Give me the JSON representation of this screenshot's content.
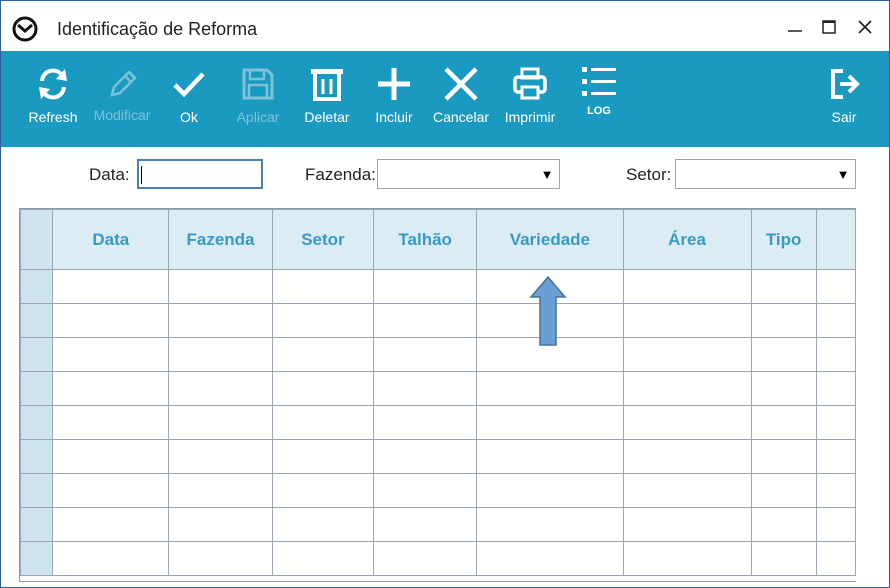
{
  "window": {
    "title": "Identificação de Reforma",
    "controls": [
      "minimize-icon",
      "maximize-icon",
      "close-icon"
    ]
  },
  "toolbar": {
    "background": "#1a9ac0",
    "buttons": [
      {
        "label": "Refresh",
        "icon": "refresh-icon",
        "enabled": true
      },
      {
        "label": "Modificar",
        "icon": "pencil-icon",
        "enabled": false
      },
      {
        "label": "Ok",
        "icon": "checkmark-icon",
        "enabled": true
      },
      {
        "label": "Aplicar",
        "icon": "save-icon",
        "enabled": false
      },
      {
        "label": "Deletar",
        "icon": "trash-icon",
        "enabled": true
      },
      {
        "label": "Incluir",
        "icon": "plus-icon",
        "enabled": true
      },
      {
        "label": "Cancelar",
        "icon": "x-icon",
        "enabled": true
      },
      {
        "label": "Imprimir",
        "icon": "printer-icon",
        "enabled": true
      },
      {
        "label": "LOG",
        "icon": "list-icon",
        "enabled": true
      },
      {
        "label": "Sair",
        "icon": "exit-icon",
        "enabled": true
      }
    ]
  },
  "filters": {
    "data": {
      "label": "Data:",
      "value": ""
    },
    "fazenda": {
      "label": "Fazenda:",
      "value": ""
    },
    "setor": {
      "label": "Setor:",
      "value": ""
    }
  },
  "grid": {
    "columns": [
      "Data",
      "Fazenda",
      "Setor",
      "Talhão",
      "Variedade",
      "Área",
      "Tipo"
    ],
    "header_color": "#dbecf4",
    "header_text_color": "#3a9ac6",
    "empty_rows": 9
  },
  "annotation": {
    "icon": "up-arrow-icon",
    "color": "#6a9fd4"
  }
}
